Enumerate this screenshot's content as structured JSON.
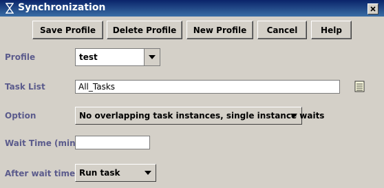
{
  "window": {
    "title": "Synchronization",
    "title_icon": "hourglass-icon",
    "close_icon": "close-icon"
  },
  "toolbar": {
    "save_profile": "Save Profile",
    "delete_profile": "Delete Profile",
    "new_profile": "New Profile",
    "cancel": "Cancel",
    "help": "Help"
  },
  "form": {
    "profile": {
      "label": "Profile",
      "value": "test"
    },
    "task_list": {
      "label": "Task List",
      "value": "All_Tasks",
      "browse_icon": "list-icon"
    },
    "option": {
      "label": "Option",
      "value": "No overlapping task instances, single instance waits"
    },
    "wait_time": {
      "label": "Wait Time (min)",
      "value": ""
    },
    "after_wait": {
      "label": "After wait time",
      "value": "Run task"
    }
  },
  "colors": {
    "title_bar": "#0a246a",
    "label_text": "#5b5b8c",
    "window_bg": "#d4d0c8"
  }
}
